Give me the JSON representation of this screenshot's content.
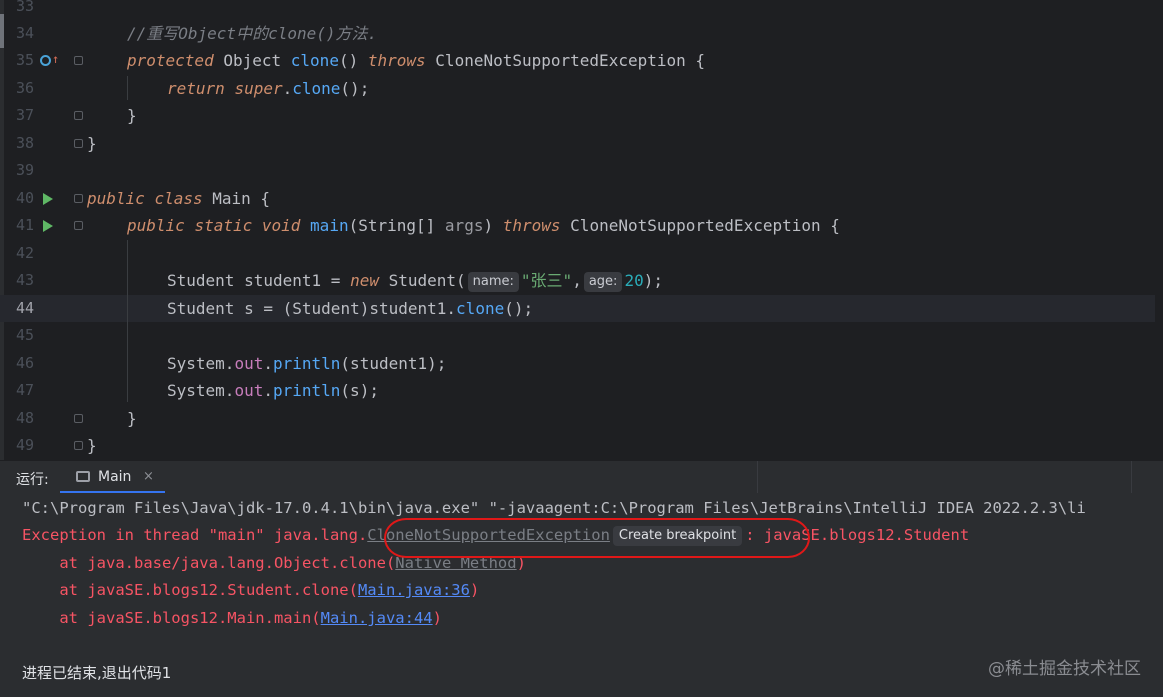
{
  "editor": {
    "line_numbers": [
      "33",
      "34",
      "35",
      "36",
      "37",
      "38",
      "39",
      "40",
      "41",
      "42",
      "43",
      "44",
      "45",
      "46",
      "47",
      "48",
      "49"
    ],
    "comment": "//重写Object中的clone()方法.",
    "clone_method": {
      "k_protected": "protected",
      "type_object": "Object",
      "name": "clone",
      "parens": "()",
      "k_throws": "throws",
      "exception": "CloneNotSupportedException",
      "brace": "{"
    },
    "return_stmt": {
      "k_return": "return",
      "k_super": "super",
      "dot": ".",
      "call": "clone",
      "tail": "();"
    },
    "close_brace": "}",
    "main_class": {
      "k_public": "public",
      "k_class": "class",
      "name": "Main",
      "brace": "{"
    },
    "main_method": {
      "k_public": "public",
      "k_static": "static",
      "k_void": "void",
      "name": "main",
      "open": "(",
      "param_type": "String[]",
      "param_name": "args",
      "close": ")",
      "k_throws": "throws",
      "exception": "CloneNotSupportedException",
      "brace": "{"
    },
    "student1_decl": {
      "type": "Student",
      "var": "student1",
      "eq": "=",
      "k_new": "new",
      "ctor": "Student(",
      "hint_name": "name:",
      "str_val": "\"张三\"",
      "comma": ",",
      "hint_age": "age:",
      "num_val": "20",
      "tail": ");"
    },
    "s_decl": {
      "type": "Student",
      "var": "s",
      "eq": "=",
      "cast": "(Student)",
      "target": "student1.",
      "call": "clone",
      "tail": "();"
    },
    "print1": {
      "cls": "System.",
      "field": "out",
      "dot": ".",
      "method": "println",
      "arg": "(student1);"
    },
    "print2": {
      "cls": "System.",
      "field": "out",
      "dot": ".",
      "method": "println",
      "arg": "(s);"
    }
  },
  "run_window": {
    "label": "运行:",
    "tab_label": "Main",
    "tab_close": "×"
  },
  "console": {
    "cmd_line": "\"C:\\Program Files\\Java\\jdk-17.0.4.1\\bin\\java.exe\" \"-javaagent:C:\\Program Files\\JetBrains\\IntelliJ IDEA 2022.2.3\\li",
    "exception": {
      "prefix": "Exception in thread \"main\" java.lang.",
      "class_link": "CloneNotSupportedException",
      "hint": "Create breakpoint",
      "suffix": ": javaSE.blogs12.Student"
    },
    "stack": [
      {
        "prefix": "    at java.base/java.lang.Object.clone(",
        "link": "Native Method",
        "suffix": ")"
      },
      {
        "prefix": "    at javaSE.blogs12.Student.clone(",
        "link": "Main.java:36",
        "suffix": ")"
      },
      {
        "prefix": "    at javaSE.blogs12.Main.main(",
        "link": "Main.java:44",
        "suffix": ")"
      }
    ],
    "exit_message": "进程已结束,退出代码1"
  },
  "watermark": "@稀土掘金技术社区",
  "colors": {
    "editor_bg": "#1e1f22",
    "panel_bg": "#2b2d30",
    "keyword": "#cf8e6d",
    "function": "#56a8f5",
    "string": "#6aab73",
    "number": "#2aacb8",
    "error": "#f75464",
    "link": "#548af7",
    "annotation": "#e01818"
  },
  "icons": [
    "run-gutter-icon",
    "override-gutter-icon",
    "fold-icon",
    "console-tab-icon",
    "close-icon"
  ]
}
